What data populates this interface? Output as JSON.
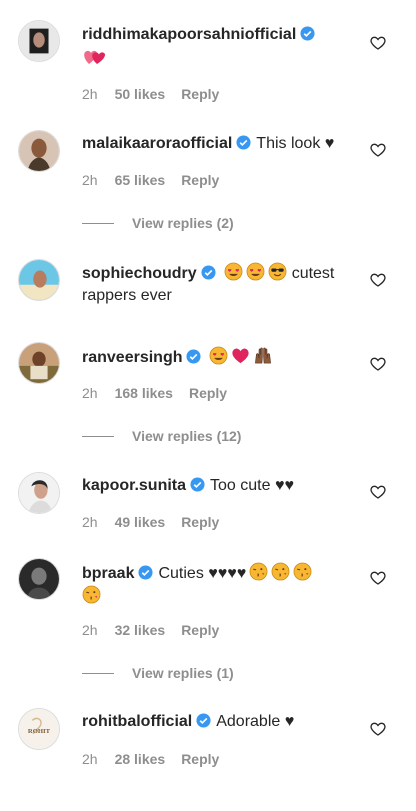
{
  "comments": [
    {
      "username": "riddhimakapoorsahniofficial",
      "text": "",
      "time": "2h",
      "likes": "50 likes",
      "reply": "Reply"
    },
    {
      "username": "malaikaaroraofficial",
      "text": "This look ♥",
      "time": "2h",
      "likes": "65 likes",
      "reply": "Reply",
      "view_replies": "View replies (2)"
    },
    {
      "username": "sophiechoudry",
      "text": "cutest",
      "text2": "rappers ever"
    },
    {
      "username": "ranveersingh",
      "text": "",
      "time": "2h",
      "likes": "168 likes",
      "reply": "Reply",
      "view_replies": "View replies (12)"
    },
    {
      "username": "kapoor.sunita",
      "text": "Too cute ♥♥",
      "time": "2h",
      "likes": "49 likes",
      "reply": "Reply"
    },
    {
      "username": "bpraak",
      "text": "Cuties ♥♥♥♥",
      "time": "2h",
      "likes": "32 likes",
      "reply": "Reply",
      "view_replies": "View replies (1)"
    },
    {
      "username": "rohitbalofficial",
      "text": "Adorable ♥",
      "time": "2h",
      "likes": "28 likes",
      "reply": "Reply",
      "avatar_text": "ROHIT"
    }
  ],
  "icons": {
    "verified": "verified-badge-icon",
    "like": "heart-outline-icon"
  },
  "colors": {
    "verified": "#3897f0",
    "meta": "#8e8e8e",
    "text": "#262626"
  }
}
